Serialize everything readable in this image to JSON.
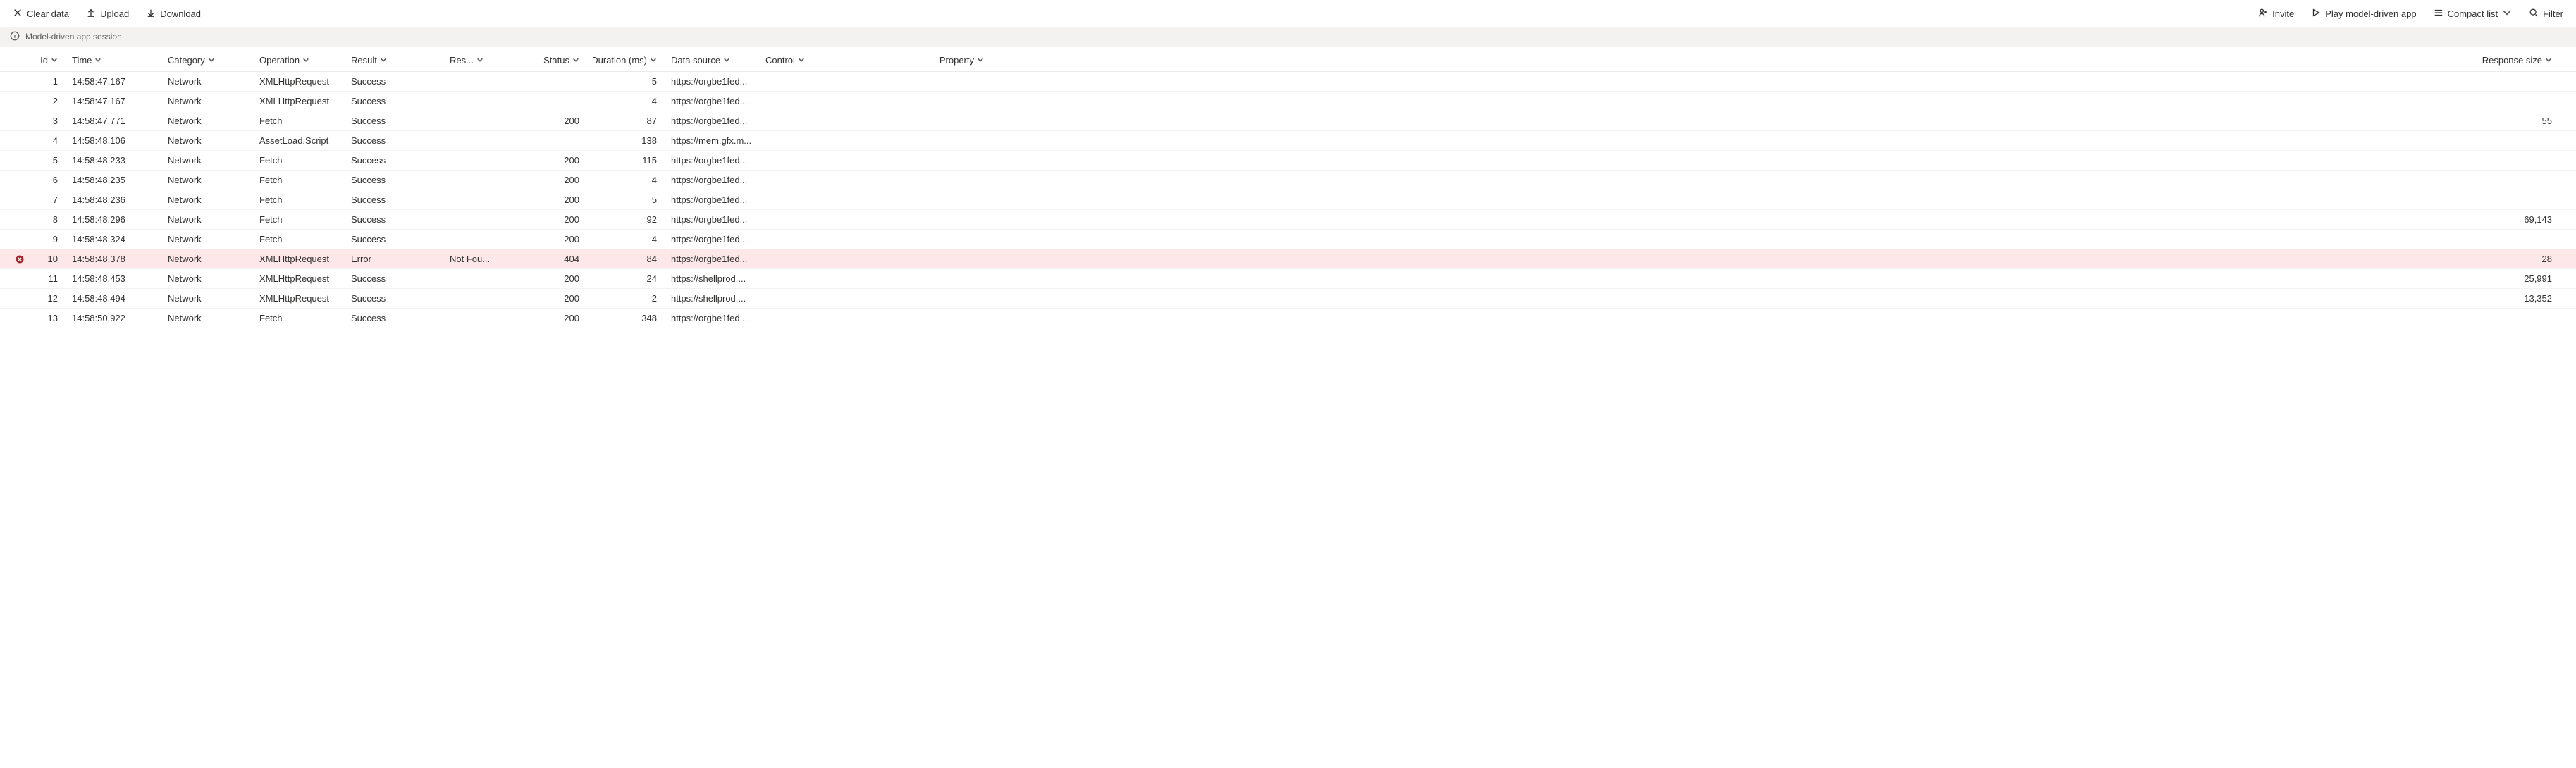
{
  "toolbar": {
    "left": {
      "clear_data": "Clear data",
      "upload": "Upload",
      "download": "Download"
    },
    "right": {
      "invite": "Invite",
      "play": "Play model-driven app",
      "compact_list": "Compact list",
      "filter": "Filter"
    }
  },
  "info_bar": {
    "message": "Model-driven app session"
  },
  "columns": [
    {
      "key": "icon",
      "label": ""
    },
    {
      "key": "id",
      "label": "Id",
      "align": "right"
    },
    {
      "key": "time",
      "label": "Time"
    },
    {
      "key": "category",
      "label": "Category"
    },
    {
      "key": "operation",
      "label": "Operation"
    },
    {
      "key": "result",
      "label": "Result"
    },
    {
      "key": "result_info",
      "label": "Res..."
    },
    {
      "key": "status",
      "label": "Status",
      "align": "right"
    },
    {
      "key": "duration",
      "label": "Duration (ms)",
      "align": "right"
    },
    {
      "key": "data_source",
      "label": "Data source"
    },
    {
      "key": "control",
      "label": "Control"
    },
    {
      "key": "property",
      "label": "Property",
      "align": "right"
    },
    {
      "key": "response_size",
      "label": "Response size",
      "align": "right"
    }
  ],
  "rows": [
    {
      "id": "1",
      "time": "14:58:47.167",
      "category": "Network",
      "operation": "XMLHttpRequest",
      "result": "Success",
      "result_info": "",
      "status": "",
      "duration": "5",
      "data_source": "https://orgbe1fed...",
      "control": "",
      "property": "",
      "response_size": ""
    },
    {
      "id": "2",
      "time": "14:58:47.167",
      "category": "Network",
      "operation": "XMLHttpRequest",
      "result": "Success",
      "result_info": "",
      "status": "",
      "duration": "4",
      "data_source": "https://orgbe1fed...",
      "control": "",
      "property": "",
      "response_size": ""
    },
    {
      "id": "3",
      "time": "14:58:47.771",
      "category": "Network",
      "operation": "Fetch",
      "result": "Success",
      "result_info": "",
      "status": "200",
      "duration": "87",
      "data_source": "https://orgbe1fed...",
      "control": "",
      "property": "",
      "response_size": "55"
    },
    {
      "id": "4",
      "time": "14:58:48.106",
      "category": "Network",
      "operation": "AssetLoad.Script",
      "result": "Success",
      "result_info": "",
      "status": "",
      "duration": "138",
      "data_source": "https://mem.gfx.m...",
      "control": "",
      "property": "",
      "response_size": ""
    },
    {
      "id": "5",
      "time": "14:58:48.233",
      "category": "Network",
      "operation": "Fetch",
      "result": "Success",
      "result_info": "",
      "status": "200",
      "duration": "115",
      "data_source": "https://orgbe1fed...",
      "control": "",
      "property": "",
      "response_size": ""
    },
    {
      "id": "6",
      "time": "14:58:48.235",
      "category": "Network",
      "operation": "Fetch",
      "result": "Success",
      "result_info": "",
      "status": "200",
      "duration": "4",
      "data_source": "https://orgbe1fed...",
      "control": "",
      "property": "",
      "response_size": ""
    },
    {
      "id": "7",
      "time": "14:58:48.236",
      "category": "Network",
      "operation": "Fetch",
      "result": "Success",
      "result_info": "",
      "status": "200",
      "duration": "5",
      "data_source": "https://orgbe1fed...",
      "control": "",
      "property": "",
      "response_size": ""
    },
    {
      "id": "8",
      "time": "14:58:48.296",
      "category": "Network",
      "operation": "Fetch",
      "result": "Success",
      "result_info": "",
      "status": "200",
      "duration": "92",
      "data_source": "https://orgbe1fed...",
      "control": "",
      "property": "",
      "response_size": "69,143"
    },
    {
      "id": "9",
      "time": "14:58:48.324",
      "category": "Network",
      "operation": "Fetch",
      "result": "Success",
      "result_info": "",
      "status": "200",
      "duration": "4",
      "data_source": "https://orgbe1fed...",
      "control": "",
      "property": "",
      "response_size": ""
    },
    {
      "id": "10",
      "time": "14:58:48.378",
      "category": "Network",
      "operation": "XMLHttpRequest",
      "result": "Error",
      "result_info": "Not Fou...",
      "status": "404",
      "duration": "84",
      "data_source": "https://orgbe1fed...",
      "control": "",
      "property": "",
      "response_size": "28",
      "error": true
    },
    {
      "id": "11",
      "time": "14:58:48.453",
      "category": "Network",
      "operation": "XMLHttpRequest",
      "result": "Success",
      "result_info": "",
      "status": "200",
      "duration": "24",
      "data_source": "https://shellprod....",
      "control": "",
      "property": "",
      "response_size": "25,991"
    },
    {
      "id": "12",
      "time": "14:58:48.494",
      "category": "Network",
      "operation": "XMLHttpRequest",
      "result": "Success",
      "result_info": "",
      "status": "200",
      "duration": "2",
      "data_source": "https://shellprod....",
      "control": "",
      "property": "",
      "response_size": "13,352"
    },
    {
      "id": "13",
      "time": "14:58:50.922",
      "category": "Network",
      "operation": "Fetch",
      "result": "Success",
      "result_info": "",
      "status": "200",
      "duration": "348",
      "data_source": "https://orgbe1fed...",
      "control": "",
      "property": "",
      "response_size": ""
    }
  ]
}
